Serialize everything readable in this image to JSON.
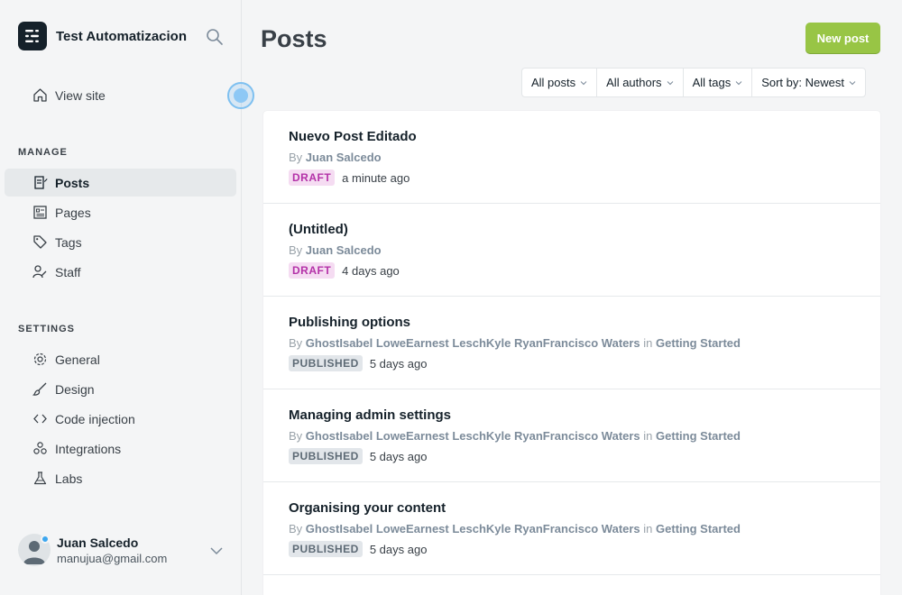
{
  "sidebar": {
    "brand_title": "Test Automatizacion",
    "view_site": "View site",
    "manage_label": "MANAGE",
    "manage_items": [
      {
        "label": "Posts",
        "icon": "posts-icon"
      },
      {
        "label": "Pages",
        "icon": "pages-icon"
      },
      {
        "label": "Tags",
        "icon": "tag-icon"
      },
      {
        "label": "Staff",
        "icon": "staff-icon"
      }
    ],
    "settings_label": "SETTINGS",
    "settings_items": [
      {
        "label": "General",
        "icon": "gear-icon"
      },
      {
        "label": "Design",
        "icon": "brush-icon"
      },
      {
        "label": "Code injection",
        "icon": "code-icon"
      },
      {
        "label": "Integrations",
        "icon": "integrations-icon"
      },
      {
        "label": "Labs",
        "icon": "flask-icon"
      }
    ],
    "user": {
      "name": "Juan Salcedo",
      "email": "manujua@gmail.com"
    }
  },
  "main": {
    "title": "Posts",
    "new_post_label": "New post",
    "filters": [
      "All posts",
      "All authors",
      "All tags",
      "Sort by: Newest"
    ],
    "posts": [
      {
        "title": "Nuevo Post Editado",
        "by": "By",
        "authors": "Juan Salcedo",
        "in": "",
        "tag": "",
        "status": "DRAFT",
        "time": "a minute ago"
      },
      {
        "title": "(Untitled)",
        "by": "By",
        "authors": "Juan Salcedo",
        "in": "",
        "tag": "",
        "status": "DRAFT",
        "time": "4 days ago"
      },
      {
        "title": "Publishing options",
        "by": "By",
        "authors": "GhostIsabel LoweEarnest LeschKyle RyanFrancisco Waters",
        "in": "in",
        "tag": "Getting Started",
        "status": "PUBLISHED",
        "time": "5 days ago"
      },
      {
        "title": "Managing admin settings",
        "by": "By",
        "authors": "GhostIsabel LoweEarnest LeschKyle RyanFrancisco Waters",
        "in": "in",
        "tag": "Getting Started",
        "status": "PUBLISHED",
        "time": "5 days ago"
      },
      {
        "title": "Organising your content",
        "by": "By",
        "authors": "GhostIsabel LoweEarnest LeschKyle RyanFrancisco Waters",
        "in": "in",
        "tag": "Getting Started",
        "status": "PUBLISHED",
        "time": "5 days ago"
      }
    ]
  },
  "colors": {
    "accent_green": "#98c545",
    "draft_pink": "#b432a8",
    "cursor_blue": "#8dc8f5"
  }
}
